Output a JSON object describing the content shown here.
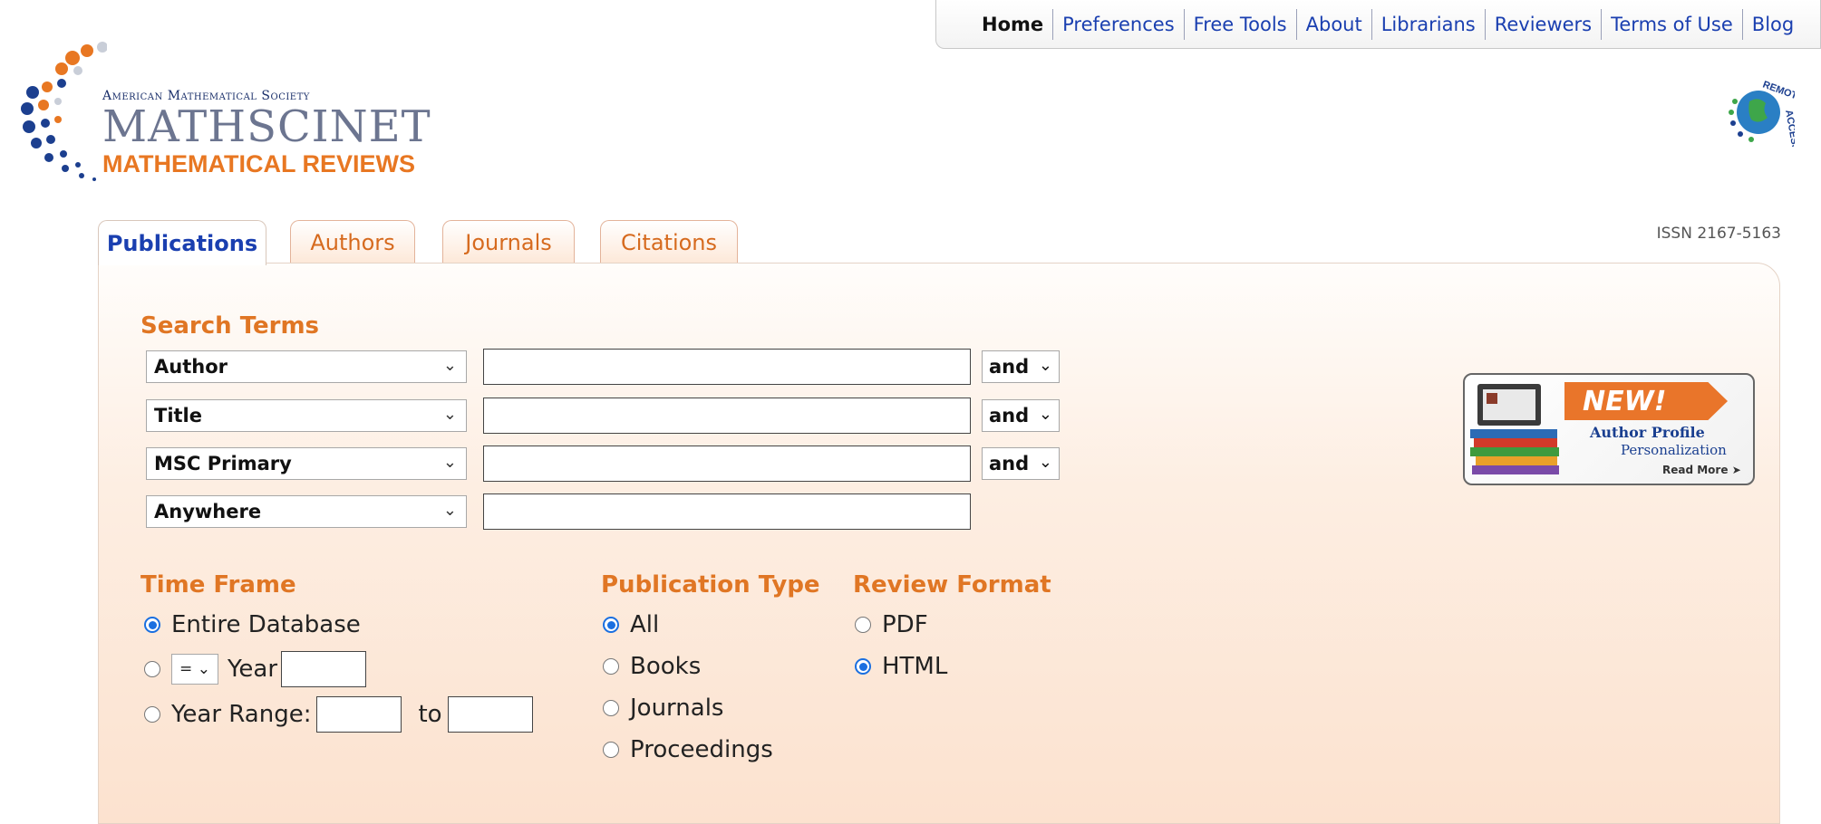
{
  "topnav": {
    "items": [
      "Home",
      "Preferences",
      "Free Tools",
      "About",
      "Librarians",
      "Reviewers",
      "Terms of Use",
      "Blog"
    ]
  },
  "logo": {
    "society": "American Mathematical Society",
    "product": "MATHSCINET",
    "subtitle": "MATHEMATICAL REVIEWS"
  },
  "remote_access": {
    "label": "REMOTE ACCESS"
  },
  "tabs": [
    "Publications",
    "Authors",
    "Journals",
    "Citations"
  ],
  "active_tab": "Publications",
  "issn": "ISSN 2167-5163",
  "search": {
    "heading": "Search Terms",
    "rows": [
      {
        "field": "Author",
        "value": "",
        "op": "and"
      },
      {
        "field": "Title",
        "value": "",
        "op": "and"
      },
      {
        "field": "MSC Primary",
        "value": "",
        "op": "and"
      },
      {
        "field": "Anywhere",
        "value": ""
      }
    ]
  },
  "time_frame": {
    "heading": "Time Frame",
    "entire": "Entire Database",
    "operator": "=",
    "year_label": "Year",
    "year_value": "",
    "range_label": "Year Range:",
    "to_label": "to",
    "range_from": "",
    "range_to": "",
    "selected": "entire"
  },
  "publication_type": {
    "heading": "Publication Type",
    "options": [
      "All",
      "Books",
      "Journals",
      "Proceedings"
    ],
    "selected": "All"
  },
  "review_format": {
    "heading": "Review Format",
    "options": [
      "PDF",
      "HTML"
    ],
    "selected": "HTML"
  },
  "promo": {
    "badge": "NEW!",
    "line1": "Author Profile",
    "line2": "Personalization",
    "link": "Read More"
  },
  "colors": {
    "accent": "#e07624",
    "link": "#1a3fb0",
    "radio": "#1a6fe0"
  }
}
